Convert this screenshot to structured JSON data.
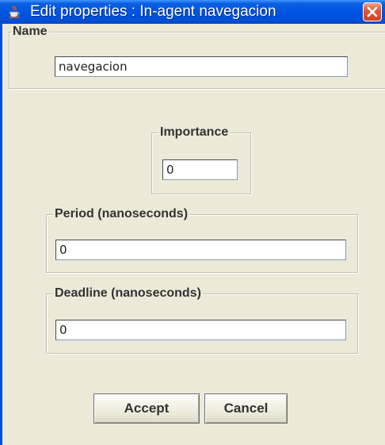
{
  "window": {
    "title": "Edit properties : In-agent navegacion",
    "icon": "java-cup-icon",
    "close_icon": "close-icon"
  },
  "name_group": {
    "label": "Name",
    "value": "navegacion"
  },
  "importance_group": {
    "label": "Importance",
    "value": "0"
  },
  "period_group": {
    "label": "Period (nanoseconds)",
    "value": "0"
  },
  "deadline_group": {
    "label": "Deadline (nanoseconds)",
    "value": "0"
  },
  "buttons": {
    "accept_label": "Accept",
    "cancel_label": "Cancel"
  },
  "colors": {
    "titlebar": "#0054e3",
    "close_button": "#d4431e",
    "window_background": "#ece9d8"
  }
}
